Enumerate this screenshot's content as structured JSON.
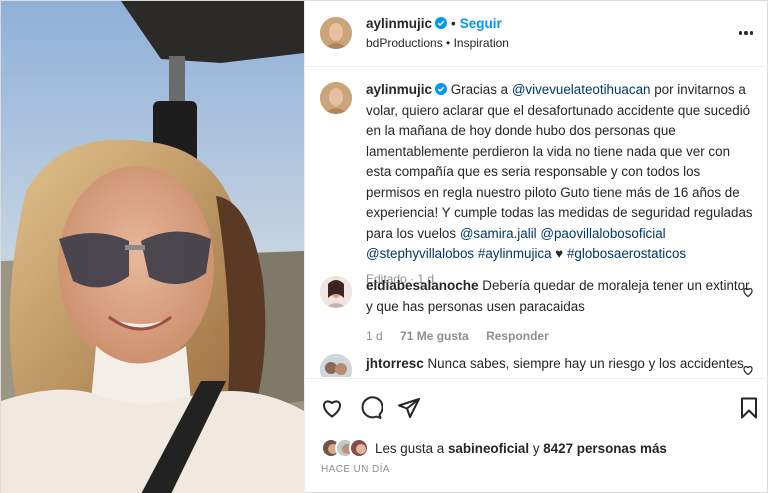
{
  "header": {
    "username": "aylinmujic",
    "follow_label": "Seguir",
    "dot": "•",
    "subtitle": "bdProductions • Inspiration"
  },
  "caption": {
    "username": "aylinmujic",
    "intro": "Gracias a",
    "mention1": "@vivevuelateotihuacan",
    "body": "por invitarnos a volar, quiero aclarar que el desafortunado accidente que sucedió en la mañana de hoy donde hubo dos personas que lamentablemente perdieron la vida no tiene nada que ver con esta compañía que es seria responsable y con todos los permisos en regla nuestro piloto Guto tiene más de 16 años de experiencia! Y cumple todas las medidas de seguridad reguladas para los vuelos",
    "mention2": "@samira.jalil",
    "mention3": "@paovillalobosoficial",
    "mention4": "@stephyvillalobos",
    "tag1": "#aylinmujica",
    "heart": "♥",
    "tag2": "#globosaerostaticos",
    "meta": "Editado · 1 d"
  },
  "comments": [
    {
      "username": "eldiabesalanoche",
      "text": "Debería quedar de moraleja tener un extintor y que has personas usen paracaidas",
      "age": "1 d",
      "likes": "71 Me gusta",
      "reply": "Responder"
    },
    {
      "username": "jhtorresc",
      "text": "Nunca sabes, siempre hay un riesgo y los accidentes"
    }
  ],
  "actions": {
    "likes_prefix": "Les gusta a",
    "likes_user": "sabineoficial",
    "likes_mid": "y",
    "likes_count": "8427 personas más",
    "time": "HACE UN DÍA"
  },
  "icons": [
    "heart-icon",
    "comment-icon",
    "share-icon",
    "bookmark-icon",
    "more-icon",
    "verified-icon"
  ],
  "colors": {
    "accent": "#0095f6",
    "link": "#00376b",
    "muted": "#8e8e8e"
  }
}
